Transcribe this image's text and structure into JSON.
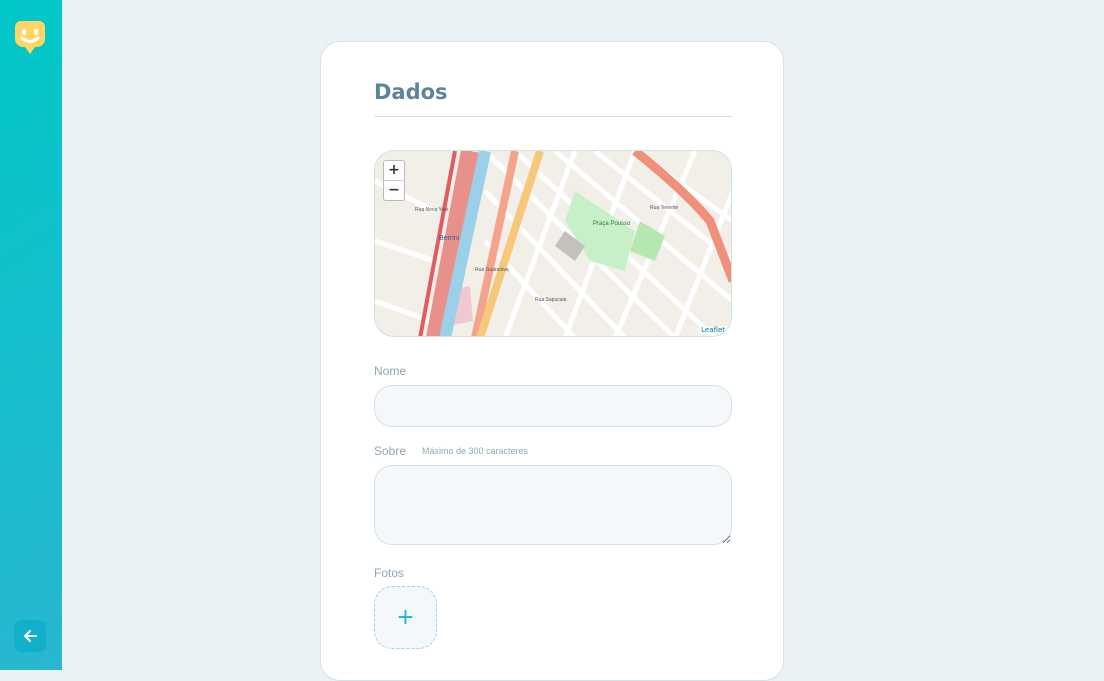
{
  "sidebar": {
    "logo_icon": "happy-face-pin-icon",
    "back_icon": "arrow-left-icon"
  },
  "form": {
    "legend": "Dados",
    "map": {
      "zoom_in": "+",
      "zoom_out": "−",
      "attribution": "Leaflet",
      "labels": [
        "Berrini",
        "Rua Guaraiúva",
        "Rua Nova York",
        "Praça Pousso",
        "Rua Tenente",
        "Rua Sapucaia"
      ]
    },
    "nome_label": "Nome",
    "nome_value": "",
    "sobre_label": "Sobre",
    "sobre_hint": "Máximo de 300 caracteres",
    "sobre_value": "",
    "fotos_label": "Fotos",
    "add_photo": "+"
  },
  "colors": {
    "sidebar_start": "#29B6D1",
    "sidebar_end": "#00C7C7",
    "legend": "#5c8599",
    "plus": "#15b6d6"
  }
}
